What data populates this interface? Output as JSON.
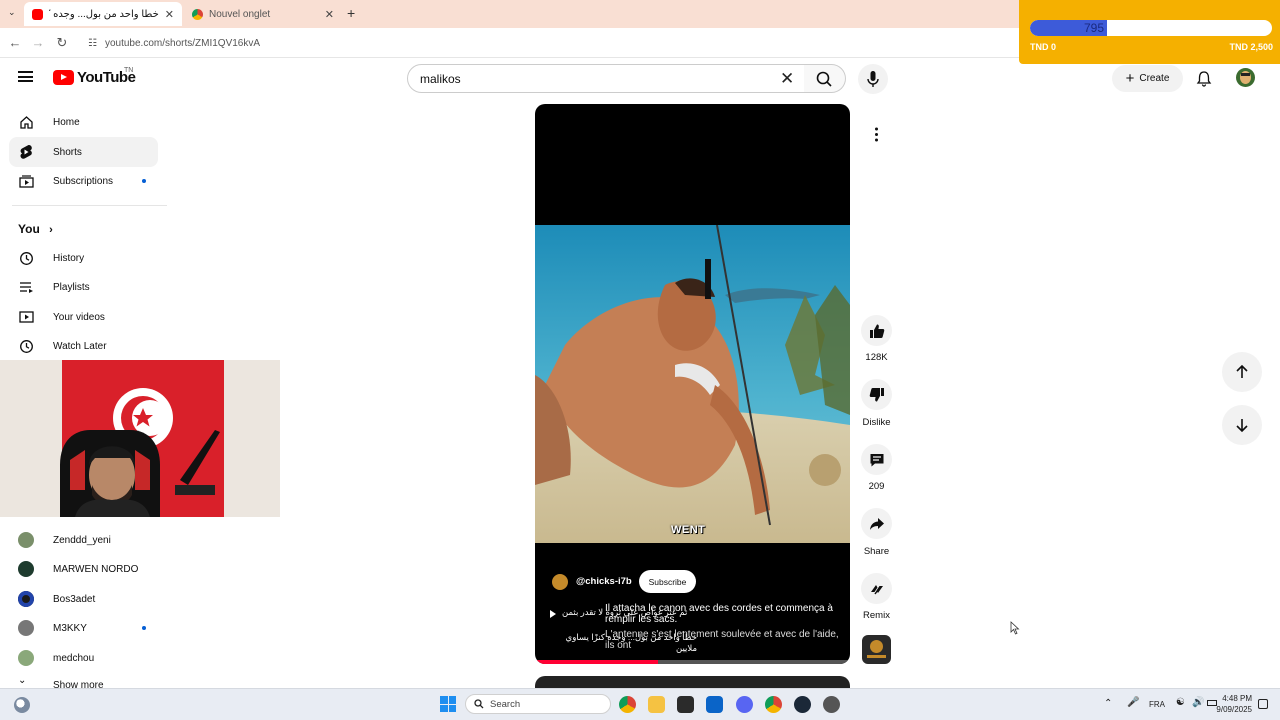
{
  "browser": {
    "tabs": [
      {
        "title": "خطأ واحد من بول... وجده كنز",
        "active": true
      },
      {
        "title": "Nouvel onglet",
        "active": false
      }
    ],
    "url": "youtube.com/shorts/ZMI1QV16kvA",
    "new_tab_symbol": "+"
  },
  "donation": {
    "current": "795",
    "min_label": "TND 0",
    "max_label": "TND 2,500",
    "progress_fraction": 0.318,
    "bar_color": "#3d5bd9",
    "bg_color": "#f5b000"
  },
  "youtube": {
    "logo_text": "YouTube",
    "country_code": "TN",
    "search_value": "malikos",
    "search_placeholder": "Search",
    "create_label": "Create"
  },
  "sidebar": {
    "items": [
      {
        "label": "Home",
        "icon": "home-icon"
      },
      {
        "label": "Shorts",
        "icon": "shorts-icon",
        "active": true
      },
      {
        "label": "Subscriptions",
        "icon": "subscriptions-icon",
        "dot": true
      }
    ],
    "you_header": "You",
    "you_items": [
      {
        "label": "History",
        "icon": "history-icon"
      },
      {
        "label": "Playlists",
        "icon": "playlists-icon"
      },
      {
        "label": "Your videos",
        "icon": "your-videos-icon"
      },
      {
        "label": "Watch Later",
        "icon": "watch-later-icon"
      }
    ],
    "channels": [
      {
        "name": "Zenddd_yeni",
        "color": "#7a8f6a"
      },
      {
        "name": "MARWEN NORDO",
        "color": "#1e3b2e"
      },
      {
        "name": "Bos3adet",
        "color": "#2244aa"
      },
      {
        "name": "M3KKY",
        "color": "#777777",
        "dot": true
      },
      {
        "name": "medchou",
        "color": "#8aa87a"
      }
    ],
    "show_more": "Show more"
  },
  "short": {
    "overlay_caption": "WENT",
    "channel_handle": "@chicks-i7b",
    "subscribe_label": "Subscribe",
    "title_ar": "ثم عثر غواص على ثروة لا تقدر بثمن",
    "title_ar_2": "خطأ واحد من بول... وجده كنزًا يساوي ملايين",
    "caption_fr_1": "Il attacha le canon avec des cordes et commença à remplir les sacs.",
    "caption_fr_2": "L'antenne s'est lentement soulevée et avec de l'aide, ils ont",
    "progress_fraction": 0.39
  },
  "actions": {
    "like_count": "128K",
    "dislike_label": "Dislike",
    "comments_count": "209",
    "share_label": "Share",
    "remix_label": "Remix"
  },
  "taskbar": {
    "search_label": "Search",
    "language": "FRA",
    "time": "4:48 PM",
    "date": "9/09/2025"
  }
}
